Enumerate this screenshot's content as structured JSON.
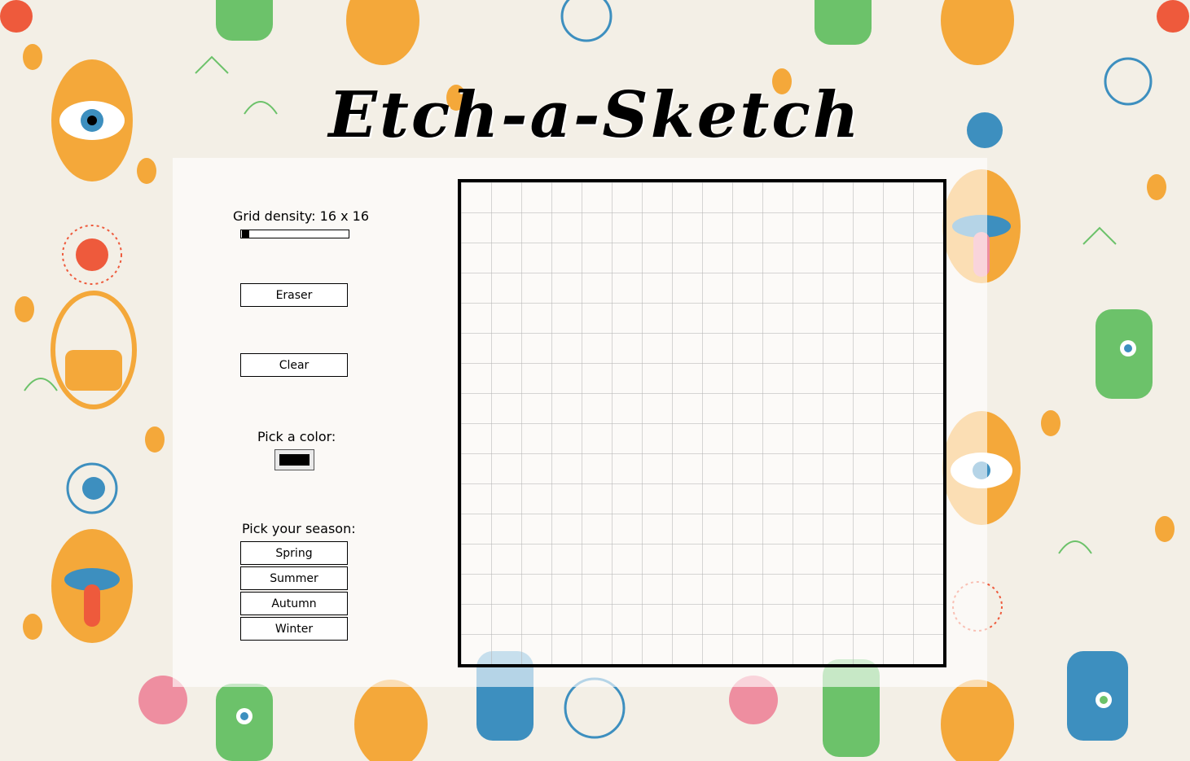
{
  "app": {
    "title": "Etch-a-Sketch"
  },
  "controls": {
    "density_label": "Grid density: 16 x 16",
    "density_value": 16,
    "eraser_label": "Eraser",
    "clear_label": "Clear",
    "color_label": "Pick a color:",
    "color_value": "#000000",
    "season_label": "Pick your season:",
    "seasons": [
      "Spring",
      "Summer",
      "Autumn",
      "Winter"
    ]
  },
  "grid": {
    "columns": 16,
    "rows": 16
  },
  "colors": {
    "accent": "#000000",
    "pattern_orange": "#f4a83a",
    "pattern_green": "#6cc26a",
    "pattern_blue": "#3d8fbf",
    "pattern_red": "#ee5a3c",
    "pattern_pink": "#ee8ea0"
  }
}
